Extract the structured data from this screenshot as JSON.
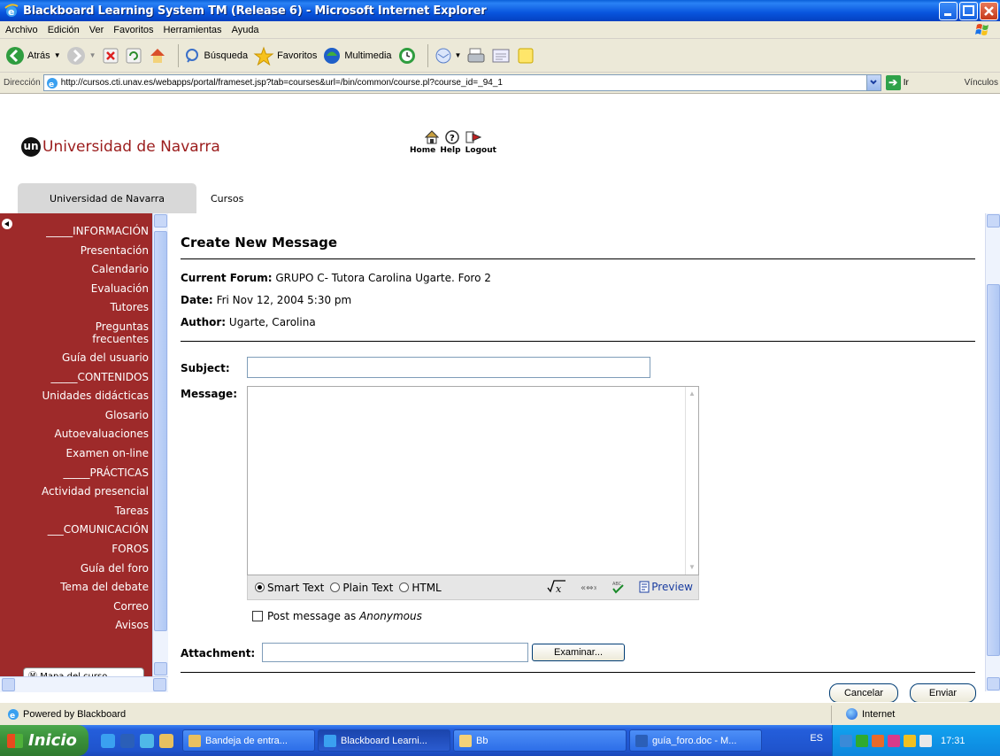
{
  "window": {
    "title": "Blackboard Learning System TM (Release 6) - Microsoft Internet Explorer"
  },
  "menu": [
    "Archivo",
    "Edición",
    "Ver",
    "Favoritos",
    "Herramientas",
    "Ayuda"
  ],
  "toolbar": {
    "back": "Atrás",
    "search": "Búsqueda",
    "favorites": "Favoritos",
    "multimedia": "Multimedia"
  },
  "address": {
    "label": "Dirección",
    "url": "http://cursos.cti.unav.es/webapps/portal/frameset.jsp?tab=courses&url=/bin/common/course.pl?course_id=_94_1",
    "go": "Ir",
    "links": "Vínculos"
  },
  "portal": {
    "logo_badge": "un",
    "brand": "Universidad de Navarra",
    "nav": {
      "home": "Home",
      "help": "Help",
      "logout": "Logout"
    },
    "tabs": {
      "active": "Universidad de Navarra",
      "courses": "Cursos"
    }
  },
  "sidebar": {
    "items": [
      "_____INFORMACIÓN",
      "Presentación",
      "Calendario",
      "Evaluación",
      "Tutores",
      "Preguntas frecuentes",
      "Guía del usuario",
      "_____CONTENIDOS",
      "Unidades didácticas",
      "Glosario",
      "Autoevaluaciones",
      "Examen on-line",
      "_____PRÁCTICAS",
      "Actividad presencial",
      "Tareas",
      "___COMUNICACIÓN",
      "FOROS",
      "Guía del foro",
      "Tema del debate",
      "Correo",
      "Avisos"
    ],
    "map_label": "Mapa del curso"
  },
  "form": {
    "title": "Create New Message",
    "forum_label": "Current Forum:",
    "forum_value": "GRUPO C- Tutora Carolina Ugarte. Foro 2",
    "date_label": "Date:",
    "date_value": "Fri Nov 12, 2004 5:30 pm",
    "author_label": "Author:",
    "author_value": "Ugarte, Carolina",
    "subject_label": "Subject:",
    "subject_value": "",
    "message_label": "Message:",
    "message_value": "",
    "text_modes": [
      "Smart Text",
      "Plain Text",
      "HTML"
    ],
    "selected_mode": "Smart Text",
    "preview": "Preview",
    "anonymous_prefix": "Post message as ",
    "anonymous_em": "Anonymous",
    "attachment_label": "Attachment:",
    "attachment_value": "",
    "browse": "Examinar...",
    "cancel": "Cancelar",
    "submit": "Enviar"
  },
  "status": {
    "left": "Powered by Blackboard",
    "zone": "Internet"
  },
  "taskbar": {
    "start": "Inicio",
    "tasks": [
      "Bandeja de entra...",
      "Blackboard Learni...",
      "Bb",
      "guía_foro.doc - M..."
    ],
    "language": "ES",
    "time": "17:31"
  }
}
